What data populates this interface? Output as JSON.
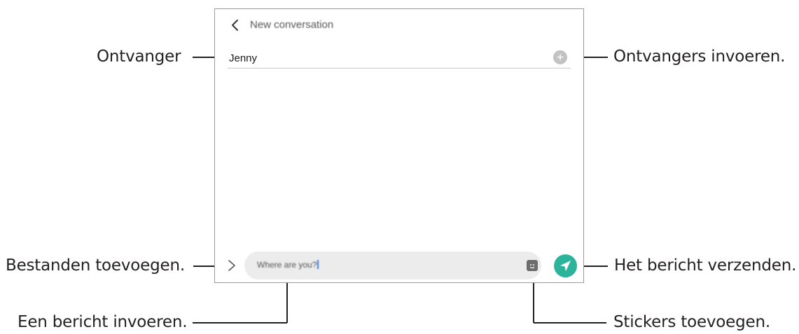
{
  "screen": {
    "title": "New conversation",
    "recipient": "Jenny",
    "message_input": "Where are you?"
  },
  "callouts": {
    "recipient": "Ontvanger",
    "add_recipients": "Ontvangers invoeren.",
    "attach_files": "Bestanden toevoegen.",
    "send_message": "Het bericht verzenden.",
    "enter_message": "Een bericht invoeren.",
    "add_stickers": "Stickers toevoegen."
  },
  "colors": {
    "send_button": "#2bb39b",
    "frame": "#9a9a9a"
  },
  "icons": [
    "back-icon",
    "add-recipient-icon",
    "expand-icon",
    "sticker-icon",
    "send-icon"
  ]
}
